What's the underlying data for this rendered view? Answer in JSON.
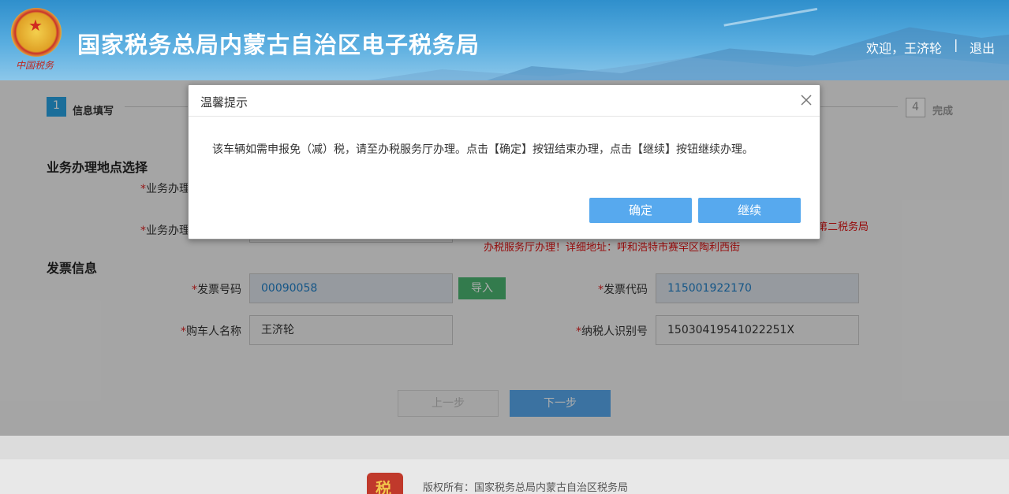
{
  "header": {
    "title": "国家税务总局内蒙古自治区电子税务局",
    "emblem_caption": "中国税务",
    "welcome": "欢迎，王济轮",
    "separator": "|",
    "logout": "退出"
  },
  "steps": {
    "current_num": "1",
    "current_label": "信息填写",
    "last_num": "4",
    "last_label": "完成"
  },
  "location_section": {
    "title": "业务办理地点选择",
    "field1_label": "业务办理",
    "field2_label": "业务办理",
    "note_line1": "第二税务局",
    "note_line2": "办税服务厅办理！详细地址：呼和浩特市赛罕区陶利西街"
  },
  "invoice_section": {
    "title": "发票信息",
    "invoice_no_label": "发票号码",
    "invoice_no": "00090058",
    "import_label": "导入",
    "invoice_code_label": "发票代码",
    "invoice_code": "115001922170",
    "buyer_label": "购车人名称",
    "buyer": "王济轮",
    "taxpayer_id_label": "纳税人识别号",
    "taxpayer_id": "15030419541022251X"
  },
  "nav": {
    "prev": "上一步",
    "next": "下一步"
  },
  "footer": {
    "copyright": "版权所有：国家税务总局内蒙古自治区税务局"
  },
  "dialog": {
    "title": "温馨提示",
    "message": "该车辆如需申报免（减）税，请至办税服务厅办理。点击【确定】按钮结束办理，点击【继续】按钮继续办理。",
    "ok": "确定",
    "continue": "继续"
  },
  "colors": {
    "accent_blue": "#57a9ee",
    "required_red": "#d22222",
    "import_green": "#4cb672"
  }
}
